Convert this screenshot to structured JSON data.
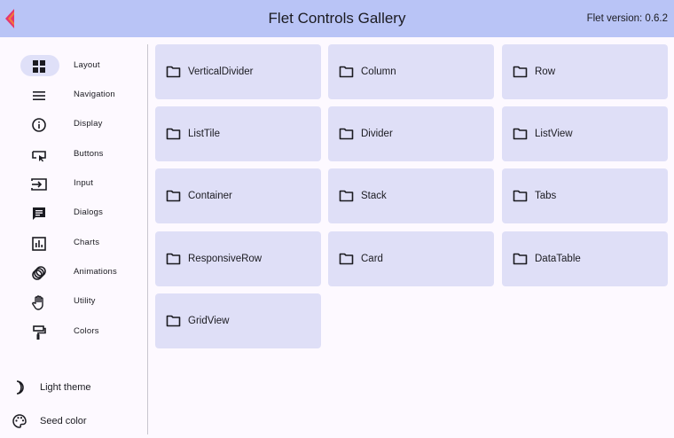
{
  "app": {
    "title": "Flet Controls Gallery",
    "version": "Flet version: 0.6.2",
    "logo_icon": "flet-logo-icon"
  },
  "rail": {
    "selected_index": 0,
    "items": [
      {
        "label": "Layout",
        "icon": "grid-view-icon"
      },
      {
        "label": "Navigation",
        "icon": "menu-icon"
      },
      {
        "label": "Display",
        "icon": "info-icon"
      },
      {
        "label": "Buttons",
        "icon": "smart-button-icon"
      },
      {
        "label": "Input",
        "icon": "input-icon"
      },
      {
        "label": "Dialogs",
        "icon": "chat-icon"
      },
      {
        "label": "Charts",
        "icon": "insert-chart-icon"
      },
      {
        "label": "Animations",
        "icon": "animation-icon"
      },
      {
        "label": "Utility",
        "icon": "pan-tool-icon"
      },
      {
        "label": "Colors",
        "icon": "format-paint-icon"
      }
    ]
  },
  "bottom": {
    "theme_label": "Light theme",
    "seed_label": "Seed color"
  },
  "controls": [
    {
      "label": "VerticalDivider"
    },
    {
      "label": "Column"
    },
    {
      "label": "Row"
    },
    {
      "label": "ListTile"
    },
    {
      "label": "Divider"
    },
    {
      "label": "ListView"
    },
    {
      "label": "Container"
    },
    {
      "label": "Stack"
    },
    {
      "label": "Tabs"
    },
    {
      "label": "ResponsiveRow"
    },
    {
      "label": "Card"
    },
    {
      "label": "DataTable"
    },
    {
      "label": "GridView"
    }
  ],
  "colors": {
    "appbar": "#b9c4f6",
    "tile": "#dfdff7",
    "selected_indicator": "#dfe0f8",
    "background": "#fdf9ff"
  }
}
